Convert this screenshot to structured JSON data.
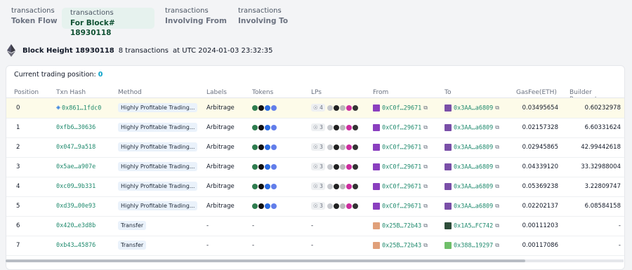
{
  "tabs": [
    {
      "line1": "transactions",
      "line2": "Token Flow"
    },
    {
      "line1": "transactions",
      "line2": "For Block# 18930118"
    },
    {
      "line1": "transactions",
      "line2": "Involving From"
    },
    {
      "line1": "transactions",
      "line2": "Involving To"
    }
  ],
  "block": {
    "title": "Block Height 18930118",
    "count": "8 transactions",
    "at": "at UTC 2024-01-03 23:32:35"
  },
  "position_line": {
    "label": "Current trading position:",
    "value": "0"
  },
  "columns": [
    "Position",
    "Txn Hash",
    "Method",
    "Labels",
    "Tokens",
    "LPs",
    "From",
    "To",
    "GasFee(ETH)",
    "Builder Payments"
  ],
  "rows": [
    {
      "position": "0",
      "hash": "0x861…1fdc0",
      "method": "Highly Profitable Trading...",
      "label": "Arbitrage",
      "tokens": true,
      "lp_count": "4",
      "from": "0xC0f…29671",
      "to": "0x3AA…a6809",
      "gas": "0.03495654",
      "builder": "0.60232978"
    },
    {
      "position": "1",
      "hash": "0xfb6…30636",
      "method": "Highly Profitable Trading...",
      "label": "Arbitrage",
      "tokens": true,
      "lp_count": "3",
      "from": "0xC0f…29671",
      "to": "0x3AA…a6809",
      "gas": "0.02157328",
      "builder": "6.60331624"
    },
    {
      "position": "2",
      "hash": "0x047…9a518",
      "method": "Highly Profitable Trading...",
      "label": "Arbitrage",
      "tokens": true,
      "lp_count": "3",
      "from": "0xC0f…29671",
      "to": "0x3AA…a6809",
      "gas": "0.02945865",
      "builder": "42.99442618"
    },
    {
      "position": "3",
      "hash": "0x5ae…a907e",
      "method": "Highly Profitable Trading...",
      "label": "Arbitrage",
      "tokens": true,
      "lp_count": "3",
      "from": "0xC0f…29671",
      "to": "0x3AA…a6809",
      "gas": "0.04339120",
      "builder": "33.32988004"
    },
    {
      "position": "4",
      "hash": "0xc09…9b331",
      "method": "Highly Profitable Trading...",
      "label": "Arbitrage",
      "tokens": true,
      "lp_count": "3",
      "from": "0xC0f…29671",
      "to": "0x3AA…a6809",
      "gas": "0.05369238",
      "builder": "3.22809747"
    },
    {
      "position": "5",
      "hash": "0xd39…00e93",
      "method": "Highly Profitable Trading...",
      "label": "Arbitrage",
      "tokens": true,
      "lp_count": "3",
      "from": "0xC0f…29671",
      "to": "0x3AA…a6809",
      "gas": "0.02202137",
      "builder": "6.08584158"
    },
    {
      "position": "6",
      "hash": "0x420…e3d8b",
      "method": "Transfer",
      "label": "-",
      "tokens": false,
      "lp_count": "",
      "tokens_dash": "-",
      "lps_dash": "-",
      "from": "0x25B…72b43",
      "to": "0x1A5…FC742",
      "gas": "0.00111203",
      "builder": "-"
    },
    {
      "position": "7",
      "hash": "0xb43…45876",
      "method": "Transfer",
      "label": "-",
      "tokens": false,
      "lp_count": "",
      "tokens_dash": "-",
      "lps_dash": "-",
      "from": "0x25B…72b43",
      "to": "0x388…19297",
      "gas": "0.00117086",
      "builder": "-"
    }
  ],
  "colors": {
    "accent": "#06a0c8",
    "address": "#1f8a6d",
    "highlight_row": "#fdfbe9",
    "active_tab": "#e6f2ee"
  },
  "icons": {
    "copy": "copy-icon",
    "ethereum": "ethereum-icon",
    "diamond": "current-position-icon"
  }
}
